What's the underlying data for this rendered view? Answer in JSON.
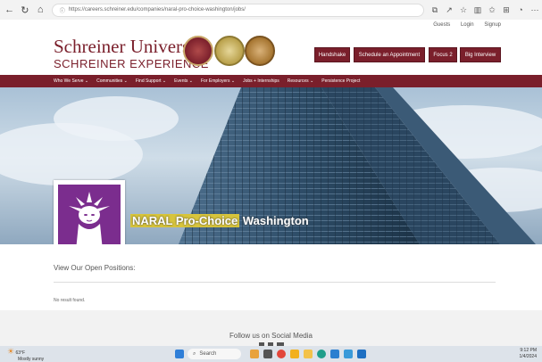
{
  "browser": {
    "url": "https://careers.schreiner.edu/companies/naral-pro-choice-washington/jobs/",
    "nav_icons": [
      "back-icon",
      "refresh-icon",
      "home-icon",
      "info-icon"
    ],
    "toolbar_icons": [
      "extension-icon",
      "share-icon",
      "star-icon",
      "split-icon",
      "favorites-icon",
      "collections-icon",
      "copilot-icon",
      "more-icon"
    ]
  },
  "header": {
    "top_links": [
      "Guests",
      "Login",
      "Signup"
    ],
    "logo_line1": "Schreiner University",
    "logo_line2": "SCHREINER EXPERIENCE",
    "buttons": [
      "Handshake",
      "Schedule an Appointment",
      "Focus 2",
      "Big Interview"
    ]
  },
  "nav": {
    "items": [
      "Who We Serve ⌄",
      "Communities ⌄",
      "Find Support ⌄",
      "Events ⌄",
      "For Employers ⌄",
      "Jobs + Internships",
      "Resources ⌄",
      "Persistence Project"
    ]
  },
  "hero": {
    "org_name_highlight": "NARAL Pro-Choice",
    "org_name_rest": " Washington"
  },
  "main": {
    "positions_title": "View Our Open Positions:",
    "no_result": "No result found."
  },
  "footer": {
    "follow_text": "Follow us on Social Media"
  },
  "taskbar": {
    "weather_temp": "63°F",
    "weather_desc": "Mostly sunny",
    "search_label": "Search",
    "time": "9:12 PM",
    "date": "1/4/2024"
  },
  "colors": {
    "brand": "#7a1f2b",
    "logo_purple": "#7b2d8e",
    "highlight": "#d7c43c"
  }
}
